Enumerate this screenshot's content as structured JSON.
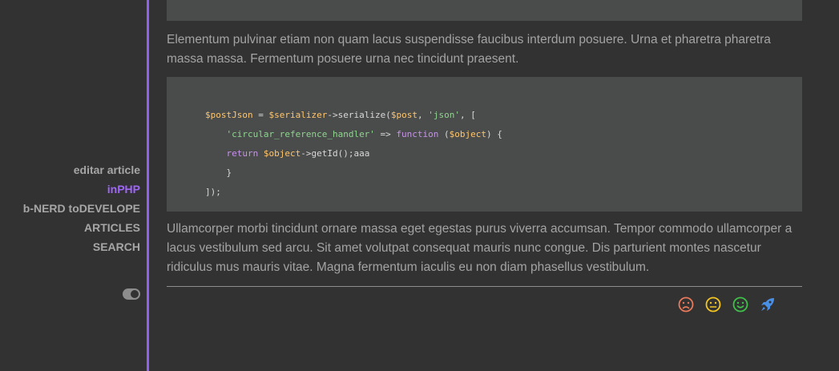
{
  "sidebar": {
    "nav": [
      {
        "label": "editar article",
        "active": false
      },
      {
        "label": "inPHP",
        "active": true
      },
      {
        "label": "b-NERD toDEVELOPE",
        "active": false
      },
      {
        "label": "ARTICLES",
        "active": false
      },
      {
        "label": "SEARCH",
        "active": false
      }
    ],
    "theme_toggle_icon": "toggle-icon"
  },
  "content": {
    "code_top_fragment": "]);",
    "paragraph1": "Elementum pulvinar etiam non quam lacus suspendisse faucibus interdum posuere. Urna et pharetra pharetra massa massa. Fermentum posuere urna nec tincidunt praesent.",
    "code": {
      "line1_var1": "$postJson",
      "line1_op1": " = ",
      "line1_var2": "$serializer",
      "line1_call": "->serialize(",
      "line1_var3": "$post",
      "line1_sep": ", ",
      "line1_str": "'json'",
      "line1_end": ", [",
      "line2_str": "'circular_reference_handler'",
      "line2_arrow": " => ",
      "line2_kw": "function",
      "line2_paren": " (",
      "line2_var": "$object",
      "line2_end": ") {",
      "line3_kw": "return",
      "line3_sp": " ",
      "line3_var": "$object",
      "line3_end": "->getId();aaa",
      "line4": "}",
      "line5": "]);"
    },
    "paragraph2": "Ullamcorper morbi tincidunt ornare massa eget egestas purus viverra accumsan. Tempor commodo ullamcorper a lacus vestibulum sed arcu. Sit amet volutpat consequat mauris nunc congue. Dis parturient montes nascetur ridiculus mus mauris vitae. Magna fermentum iaculis eu non diam phasellus vestibulum."
  },
  "reactions": [
    {
      "icon": "sad-face-icon",
      "color": "#e8795a"
    },
    {
      "icon": "neutral-face-icon",
      "color": "#f3c623"
    },
    {
      "icon": "happy-face-icon",
      "color": "#3fc14a"
    },
    {
      "icon": "rocket-icon",
      "color": "#4a8fe6"
    }
  ],
  "colors": {
    "accent": "#8f62f2",
    "background": "#323232",
    "code_background": "#4a4b4b"
  }
}
